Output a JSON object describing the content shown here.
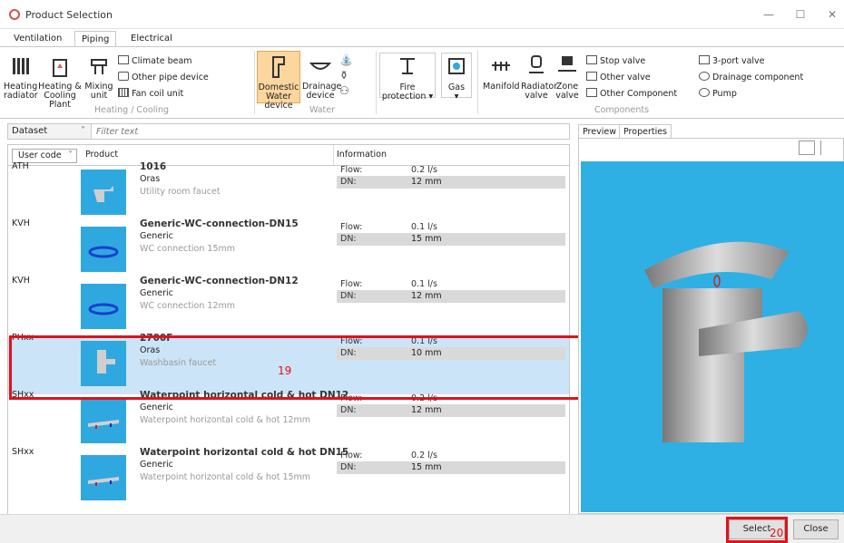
{
  "window": {
    "title": "Product Selection",
    "minimize": "—",
    "maximize": "☐",
    "close": "✕"
  },
  "tabs": [
    {
      "label": "Ventilation"
    },
    {
      "label": "Piping"
    },
    {
      "label": "Electrical"
    }
  ],
  "ribbon": {
    "heating_radiator": "Heating radiator",
    "heating_cooling_plant": "Heating & Cooling Plant",
    "mixing_unit": "Mixing unit",
    "climate_beam": "Climate beam",
    "other_pipe_device": "Other pipe device",
    "fan_coil_unit": "Fan coil unit",
    "group_heating": "Heating / Cooling",
    "domestic_water": "Domestic Water device",
    "drainage_device": "Drainage device",
    "group_water": "Water",
    "fire_protection": "Fire protection ▾",
    "gas": "Gas",
    "gas_arrow": "▾",
    "manifold": "Manifold",
    "radiator_valve": "Radiator valve",
    "zone_valve": "Zone valve",
    "stop_valve": "Stop valve",
    "other_valve": "Other valve",
    "other_component": "Other Component",
    "three_port_valve": "3-port valve",
    "drainage_component": "Drainage component",
    "pump": "Pump",
    "group_components": "Components"
  },
  "filter": {
    "dataset": "Dataset",
    "placeholder": "Filter text",
    "arrow": "˅"
  },
  "list_header": {
    "user_code": "User code",
    "product": "Product",
    "information": "Information",
    "arrow": "˅"
  },
  "products": [
    {
      "code": "ATH",
      "name": "1016",
      "manufacturer": "Oras",
      "description": "Utility room faucet",
      "flow_label": "Flow:",
      "flow": "0.2 l/s",
      "dn_label": "DN:",
      "dn": "12 mm"
    },
    {
      "code": "KVH",
      "name": "Generic-WC-connection-DN15",
      "manufacturer": "Generic",
      "description": "WC connection 15mm",
      "flow_label": "Flow:",
      "flow": "0.1 l/s",
      "dn_label": "DN:",
      "dn": "15 mm"
    },
    {
      "code": "KVH",
      "name": "Generic-WC-connection-DN12",
      "manufacturer": "Generic",
      "description": "WC connection 12mm",
      "flow_label": "Flow:",
      "flow": "0.1 l/s",
      "dn_label": "DN:",
      "dn": "12 mm"
    },
    {
      "code": "PHxx",
      "name": "2700F",
      "manufacturer": "Oras",
      "description": "Washbasin faucet",
      "flow_label": "Flow:",
      "flow": "0.1 l/s",
      "dn_label": "DN:",
      "dn": "10 mm"
    },
    {
      "code": "SHxx",
      "name": "Waterpoint horizontal cold & hot DN12",
      "manufacturer": "Generic",
      "description": "Waterpoint horizontal cold & hot 12mm",
      "flow_label": "Flow:",
      "flow": "0.2 l/s",
      "dn_label": "DN:",
      "dn": "12 mm"
    },
    {
      "code": "SHxx",
      "name": "Waterpoint horizontal cold & hot DN15",
      "manufacturer": "Generic",
      "description": "Waterpoint horizontal cold & hot 15mm",
      "flow_label": "Flow:",
      "flow": "0.2 l/s",
      "dn_label": "DN:",
      "dn": "15 mm"
    }
  ],
  "preview": {
    "tab_preview": "Preview",
    "tab_properties": "Properties"
  },
  "footer": {
    "select": "Select",
    "close": "Close"
  },
  "annotations": {
    "row_marker": "19",
    "select_marker": "20"
  },
  "colors": {
    "accent_blue": "#2fb0e4",
    "highlight": "#e0121b",
    "selected_row": "#cce4f7",
    "ribbon_selected": "#fbd69e"
  }
}
